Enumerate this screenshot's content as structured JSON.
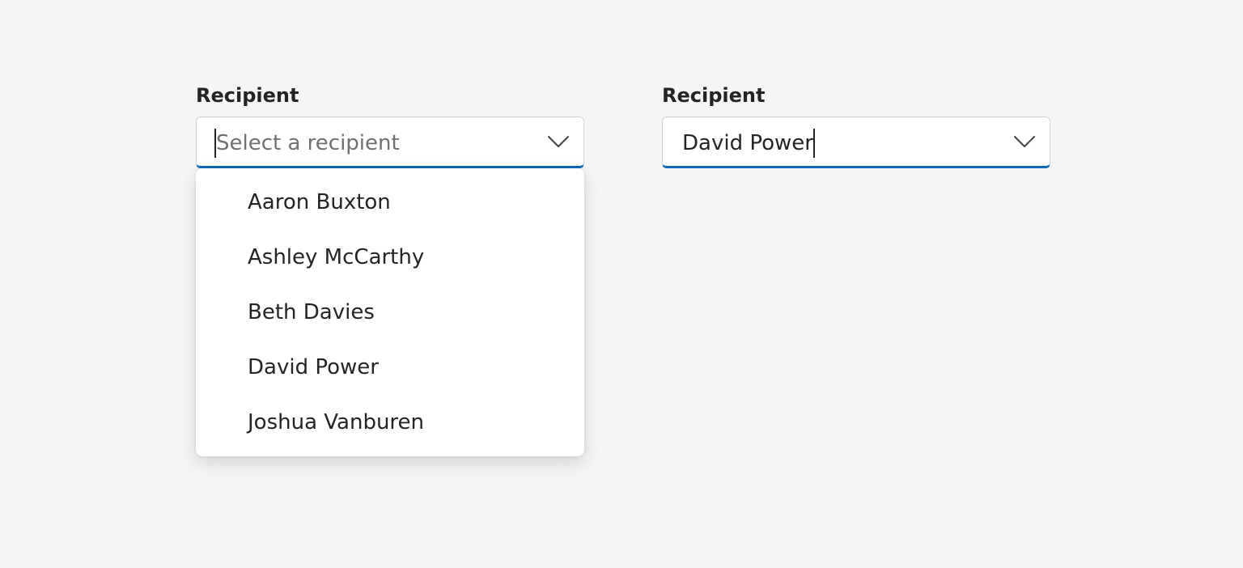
{
  "left_combobox": {
    "label": "Recipient",
    "placeholder": "Select a recipient",
    "expanded": true,
    "options": [
      "Aaron Buxton",
      "Ashley McCarthy",
      "Beth Davies",
      "David Power",
      "Joshua Vanburen"
    ],
    "chevron_icon": "chevron-down-icon"
  },
  "right_combobox": {
    "label": "Recipient",
    "value": "David Power",
    "expanded": false,
    "chevron_icon": "chevron-down-icon"
  },
  "colors": {
    "background": "#f5f5f5",
    "accent_underline": "#0f6cbd",
    "text": "#242424",
    "placeholder": "#707070"
  }
}
